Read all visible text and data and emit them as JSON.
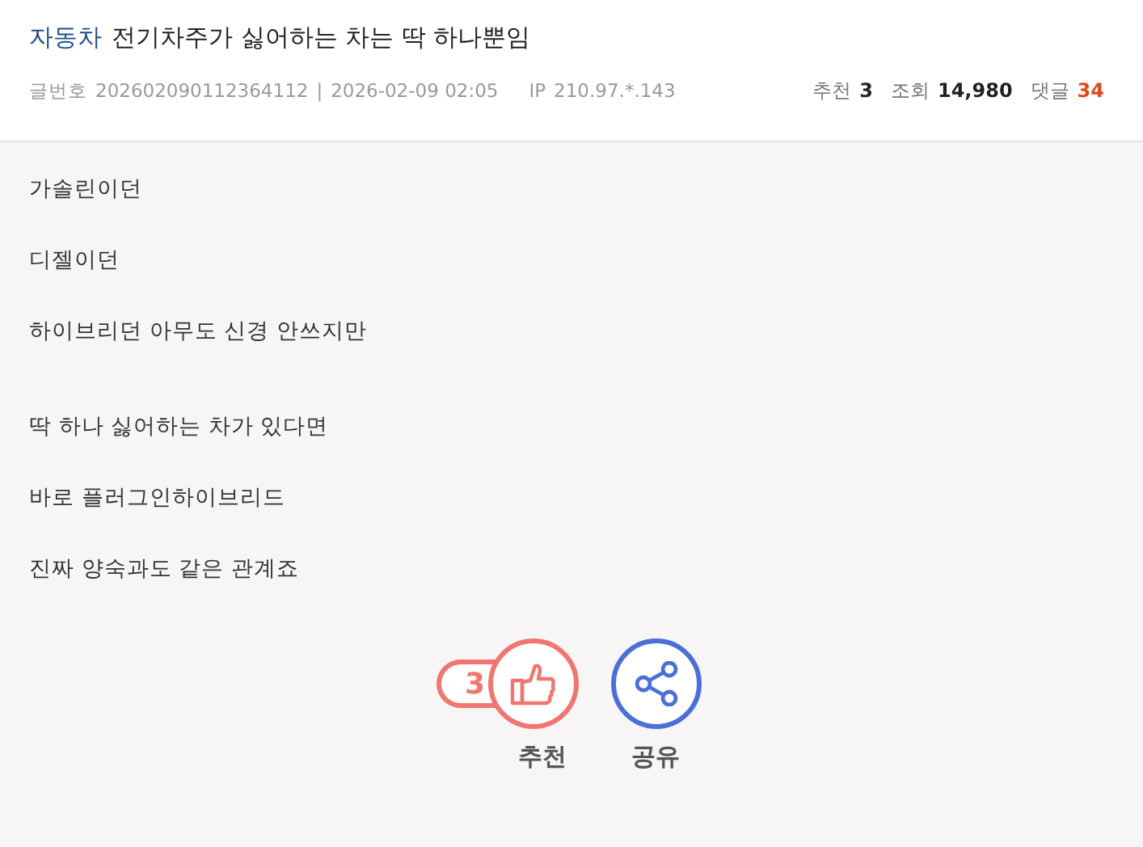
{
  "post": {
    "category": "자동차",
    "title": "전기차주가 싫어하는 차는 딱 하나뿐임",
    "meta": {
      "number_label": "글번호",
      "number": "202602090112364112",
      "separator": "|",
      "datetime": "2026-02-09 02:05",
      "ip_label": "IP",
      "ip": "210.97.*.143"
    },
    "stats": [
      {
        "label": "추천",
        "value": "3",
        "kind": "plain"
      },
      {
        "label": "조회",
        "value": "14,980",
        "kind": "plain"
      },
      {
        "label": "댓글",
        "value": "34",
        "kind": "accent"
      }
    ]
  },
  "paragraph_groups": [
    [
      "가솔린이던",
      "디젤이던",
      "하이브리던 아무도 신경 안쓰지만"
    ],
    [
      "딱 하나 싫어하는 차가 있다면",
      "바로 플러그인하이브리드",
      "진짜 양숙과도 같은 관계죠"
    ]
  ],
  "actions": [
    {
      "kind": "recommend",
      "count": "3",
      "label": "추천"
    },
    {
      "kind": "share",
      "label": "공유"
    }
  ]
}
